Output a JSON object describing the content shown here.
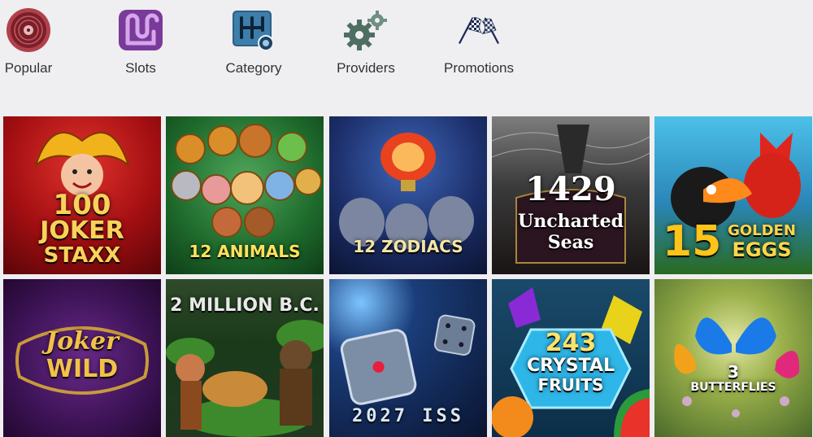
{
  "nav": {
    "items": [
      {
        "label": "Popular",
        "icon": "record-icon"
      },
      {
        "label": "Slots",
        "icon": "slots-track-icon"
      },
      {
        "label": "Category",
        "icon": "gear-shift-icon"
      },
      {
        "label": "Providers",
        "icon": "gears-icon"
      },
      {
        "label": "Promotions",
        "icon": "checkered-flags-icon"
      }
    ]
  },
  "games": [
    {
      "name": "100 Joker Staxx",
      "line1": "100",
      "line2": "JOKER",
      "line3": "STAXX"
    },
    {
      "name": "12 Animals",
      "line1": "12 ANIMALS"
    },
    {
      "name": "12 Zodiacs",
      "line1": "12 ZODIACS"
    },
    {
      "name": "1429 Uncharted Seas",
      "line1": "1429",
      "line2": "Uncharted",
      "line3": "Seas"
    },
    {
      "name": "15 Golden Eggs",
      "line1": "15",
      "line2": "GOLDEN",
      "line3": "EGGS"
    },
    {
      "name": "Joker Wild",
      "line1": "Joker",
      "line2": "WILD"
    },
    {
      "name": "2 Million B.C.",
      "line1": "2 MILLION B.C."
    },
    {
      "name": "2027 ISS",
      "line1": "2027 ISS"
    },
    {
      "name": "243 Crystal Fruits",
      "line1": "243",
      "line2": "CRYSTAL",
      "line3": "FRUITS"
    },
    {
      "name": "3 Butterflies",
      "line1": "3",
      "line2": "BUTTERFLIES"
    }
  ]
}
